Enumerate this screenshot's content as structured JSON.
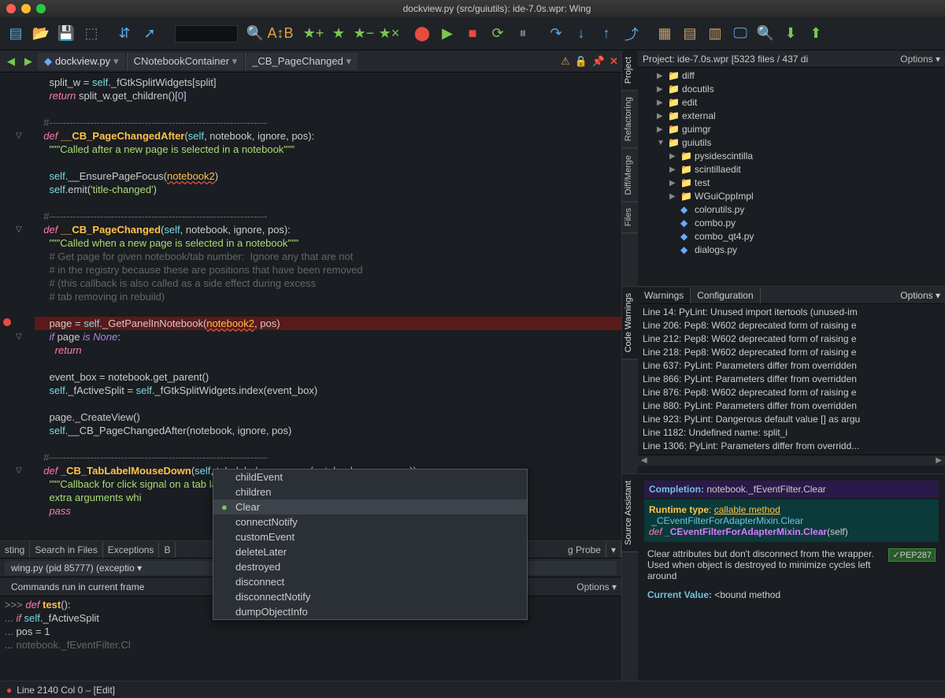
{
  "title": "dockview.py (src/guiutils): ide-7.0s.wpr: Wing",
  "toolbar_icons": [
    "new-file",
    "open-folder",
    "save",
    "save-all",
    "indent",
    "arrow",
    "search",
    "find-replace",
    "bookmark-add",
    "bookmark",
    "bookmark-rm",
    "clear-bm",
    "record",
    "play",
    "stop",
    "reload",
    "pause",
    "step-over",
    "step-in",
    "step-out",
    "step-return",
    "grid1",
    "grid2",
    "grid3",
    "monitor",
    "zoom",
    "download",
    "upload"
  ],
  "nav": {
    "file": "dockview.py",
    "crumbs": [
      "CNotebookContainer",
      "_CB_PageChanged"
    ],
    "icons": [
      "warn",
      "lock",
      "pin"
    ]
  },
  "code": [
    {
      "t": "    split_w = self._fGtkSplitWidgets[split]"
    },
    {
      "t": "    return split_w.get_children()[0]",
      "kw": "return"
    },
    {
      "t": ""
    },
    {
      "t": "  #----------------------------------------------------------------",
      "cmt": true
    },
    {
      "t": "  def __CB_PageChangedAfter(self, notebook, ignore, pos):",
      "def": true,
      "fn": "__CB_PageChangedAfter",
      "fold": "down"
    },
    {
      "t": "    \"\"\"Called after a new page is selected in a notebook\"\"\"",
      "str": true
    },
    {
      "t": ""
    },
    {
      "t": "    self.__EnsurePageFocus(notebook2)",
      "err": "notebook2"
    },
    {
      "t": "    self.emit('title-changed')",
      "str2": "'title-changed'"
    },
    {
      "t": ""
    },
    {
      "t": "  #----------------------------------------------------------------",
      "cmt": true
    },
    {
      "t": "  def __CB_PageChanged(self, notebook, ignore, pos):",
      "def": true,
      "fn": "__CB_PageChanged",
      "fold": "down"
    },
    {
      "t": "    \"\"\"Called when a new page is selected in a notebook\"\"\"",
      "str": true
    },
    {
      "t": "    # Get page for given notebook/tab number:  Ignore any that are not",
      "cmt": true
    },
    {
      "t": "    # in the registry because these are positions that have been removed",
      "cmt": true
    },
    {
      "t": "    # (this callback is also called as a side effect during excess",
      "cmt": true
    },
    {
      "t": "    # tab removing in rebuild)",
      "cmt": true
    },
    {
      "t": ""
    },
    {
      "t": "    page = self._GetPanelInNotebook(notebook2, pos)",
      "hl": true,
      "err": "notebook2",
      "bp": true
    },
    {
      "t": "    if page is None:",
      "kw2": true,
      "fold": "down"
    },
    {
      "t": "      return",
      "kw": "return"
    },
    {
      "t": ""
    },
    {
      "t": "    event_box = notebook.get_parent()"
    },
    {
      "t": "    self._fActiveSplit = self._fGtkSplitWidgets.index(event_box)"
    },
    {
      "t": ""
    },
    {
      "t": "    page._CreateView()"
    },
    {
      "t": "    self.__CB_PageChangedAfter(notebook, ignore, pos)"
    },
    {
      "t": ""
    },
    {
      "t": "  #----------------------------------------------------------------",
      "cmt": true
    },
    {
      "t": "  def _CB_TabLabelMouseDown(self, tab_label, press_ev, (notebook, page_num)):",
      "def": true,
      "fn": "_CB_TabLabelMouseDown",
      "fold": "down"
    },
    {
      "t": "    \"\"\"Callback for click signal on a tab label. notebook and page_num are",
      "str": true
    },
    {
      "t": "    extra arguments whi",
      "str": true
    },
    {
      "t": "    pass",
      "kw": "pass"
    }
  ],
  "autocomplete": [
    "childEvent",
    "children",
    "Clear",
    "connectNotify",
    "customEvent",
    "deleteLater",
    "destroyed",
    "disconnect",
    "disconnectNotify",
    "dumpObjectInfo"
  ],
  "autocomplete_sel": 2,
  "bottom": {
    "tabs": [
      "sting",
      "Search in Files",
      "Exceptions",
      "B",
      "g Probe"
    ],
    "process": "wing.py (pid 85777) (exceptio",
    "desc": "Commands run in current frame",
    "options": "Options",
    "repl": [
      {
        "p": ">>>",
        "c": "def test():",
        "def": true,
        "fn": "test"
      },
      {
        "p": "...",
        "c": "  if self._fActiveSplit",
        "kw": "if"
      },
      {
        "p": "...",
        "c": "    pos = 1"
      },
      {
        "p": "...",
        "c": "    notebook._fEventFilter.Cl",
        "dim": true
      }
    ]
  },
  "status": "Line 2140 Col 0 – [Edit]",
  "project": {
    "title": "Project: ide-7.0s.wpr [5323 files / 437 di",
    "options": "Options",
    "vtabs": [
      "Project",
      "Refactoring",
      "Diff/Merge",
      "Files"
    ],
    "tree": [
      {
        "d": 1,
        "ex": false,
        "ic": "fld",
        "n": "diff"
      },
      {
        "d": 1,
        "ex": false,
        "ic": "fld",
        "n": "docutils"
      },
      {
        "d": 1,
        "ex": false,
        "ic": "fld",
        "n": "edit"
      },
      {
        "d": 1,
        "ex": false,
        "ic": "fld",
        "n": "external"
      },
      {
        "d": 1,
        "ex": false,
        "ic": "fld",
        "n": "guimgr"
      },
      {
        "d": 1,
        "ex": true,
        "ic": "fld",
        "n": "guiutils"
      },
      {
        "d": 2,
        "ex": false,
        "ic": "fld",
        "n": "pysidescintilla"
      },
      {
        "d": 2,
        "ex": false,
        "ic": "fld",
        "n": "scintillaedit"
      },
      {
        "d": 2,
        "ex": false,
        "ic": "fld",
        "n": "test"
      },
      {
        "d": 2,
        "ex": false,
        "ic": "fld",
        "n": "WGuiCppImpl"
      },
      {
        "d": 2,
        "ic": "py",
        "n": "colorutils.py"
      },
      {
        "d": 2,
        "ic": "py",
        "n": "combo.py"
      },
      {
        "d": 2,
        "ic": "py",
        "n": "combo_qt4.py"
      },
      {
        "d": 2,
        "ic": "py",
        "n": "dialogs.py"
      }
    ]
  },
  "warnings": {
    "vtabs": [
      "Code Warnings"
    ],
    "htabs": [
      "Warnings",
      "Configuration"
    ],
    "options": "Options",
    "lines": [
      "Line 14: PyLint: Unused import itertools (unused-im",
      "Line 206: Pep8: W602 deprecated form of raising e",
      "Line 212: Pep8: W602 deprecated form of raising e",
      "Line 218: Pep8: W602 deprecated form of raising e",
      "Line 637: PyLint: Parameters differ from overridden",
      "Line 866: PyLint: Parameters differ from overridden",
      "Line 876: Pep8: W602 deprecated form of raising e",
      "Line 880: PyLint: Parameters differ from overridden",
      "Line 923: PyLint: Dangerous default value [] as argu",
      "Line 1182: Undefined name: split_i",
      "Line 1306: PyLint: Parameters differ from overridd..."
    ]
  },
  "assist": {
    "vtabs": [
      "Source Assistant"
    ],
    "completion_lbl": "Completion:",
    "completion_val": "notebook._fEventFilter.Clear",
    "rt_lbl": "Runtime type",
    "rt_link": "callable method",
    "rt_class": "_CEventFilterForAdapterMixin.Clear",
    "rt_sig_def": "def",
    "rt_sig_meth": "_CEventFilterForAdapterMixin.Clear",
    "rt_sig_args": "(self)",
    "pep": "PEP287",
    "doc": "Clear attributes but don't disconnect from the wrapper. Used when object is destroyed to minimize cycles left around",
    "cur_lbl": "Current Value:",
    "cur_val": "<bound method"
  }
}
